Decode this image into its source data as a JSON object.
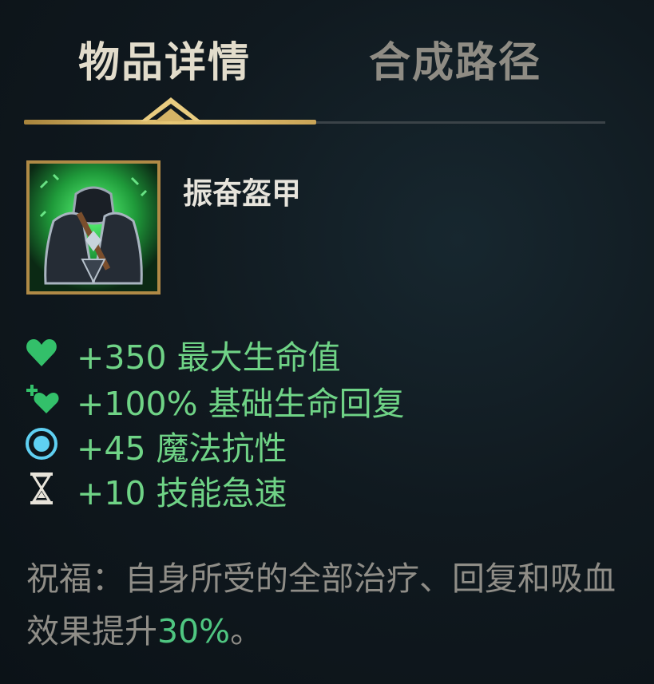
{
  "tabs": {
    "details_label": "物品详情",
    "recipe_label": "合成路径"
  },
  "item": {
    "name": "振奋盔甲",
    "icon": "armor-item-icon"
  },
  "stats": [
    {
      "icon": "heart-icon",
      "text": "+350 最大生命值"
    },
    {
      "icon": "heal-regen-icon",
      "text": "+100% 基础生命回复"
    },
    {
      "icon": "magic-resist-icon",
      "text": "+45 魔法抗性"
    },
    {
      "icon": "hourglass-icon",
      "text": "+10 技能急速"
    }
  ],
  "passive": {
    "text_before": "祝福：自身所受的全部治疗、回复和吸血效果提升",
    "highlight": "30%",
    "text_after": "。"
  },
  "colors": {
    "gold_accent": "#e7c775",
    "stat_green": "#6fd386",
    "highlight_green": "#4fc681",
    "magic_resist_blue": "#5fd0f2",
    "passive_gray": "#8f8d87"
  }
}
